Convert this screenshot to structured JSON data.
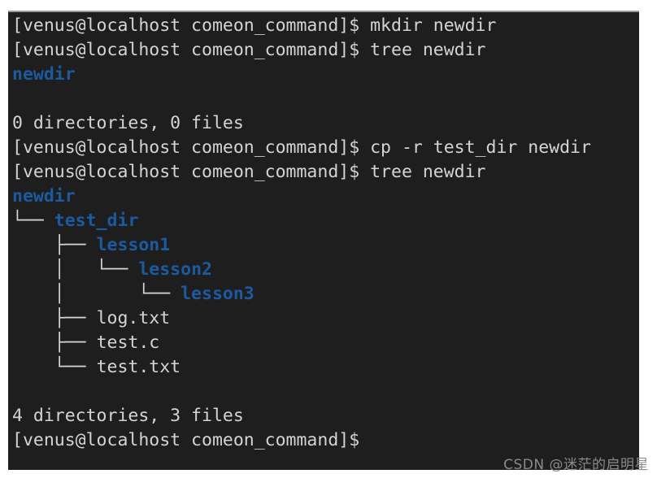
{
  "terminal": {
    "background_color": "#1e1e1e",
    "text_color": "#d4d4d4",
    "directory_color": "#1c5aa0",
    "prompt": "[venus@localhost comeon_command]$ ",
    "lines": [
      {
        "id": "l01",
        "type": "command",
        "prompt": "[venus@localhost comeon_command]$ ",
        "command": "mkdir newdir"
      },
      {
        "id": "l02",
        "type": "command",
        "prompt": "[venus@localhost comeon_command]$ ",
        "command": "tree newdir"
      },
      {
        "id": "l03",
        "type": "dir",
        "branch": "",
        "name": "newdir"
      },
      {
        "id": "l04",
        "type": "blank",
        "text": ""
      },
      {
        "id": "l05",
        "type": "output",
        "text": "0 directories, 0 files"
      },
      {
        "id": "l06",
        "type": "command",
        "prompt": "[venus@localhost comeon_command]$ ",
        "command": "cp -r test_dir newdir"
      },
      {
        "id": "l07",
        "type": "command",
        "prompt": "[venus@localhost comeon_command]$ ",
        "command": "tree newdir"
      },
      {
        "id": "l08",
        "type": "dir",
        "branch": "",
        "name": "newdir"
      },
      {
        "id": "l09",
        "type": "dir",
        "branch": "└── ",
        "name": "test_dir"
      },
      {
        "id": "l10",
        "type": "dir",
        "branch": "    ├── ",
        "name": "lesson1"
      },
      {
        "id": "l11",
        "type": "dir",
        "branch": "    │   └── ",
        "name": "lesson2"
      },
      {
        "id": "l12",
        "type": "dir",
        "branch": "    │       └── ",
        "name": "lesson3"
      },
      {
        "id": "l13",
        "type": "file",
        "branch": "    ├── ",
        "name": "log.txt"
      },
      {
        "id": "l14",
        "type": "file",
        "branch": "    ├── ",
        "name": "test.c"
      },
      {
        "id": "l15",
        "type": "file",
        "branch": "    └── ",
        "name": "test.txt"
      },
      {
        "id": "l16",
        "type": "blank",
        "text": ""
      },
      {
        "id": "l17",
        "type": "output",
        "text": "4 directories, 3 files"
      },
      {
        "id": "l18",
        "type": "prompt",
        "prompt": "[venus@localhost comeon_command]$ ",
        "command": ""
      }
    ]
  },
  "watermark": {
    "text": "CSDN @迷茫的启明星"
  }
}
